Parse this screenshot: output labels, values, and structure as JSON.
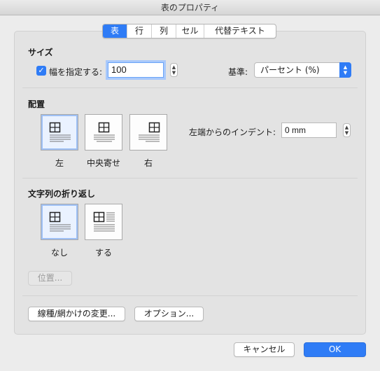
{
  "window": {
    "title": "表のプロパティ"
  },
  "tabs": [
    {
      "label": "表",
      "active": true
    },
    {
      "label": "行",
      "active": false
    },
    {
      "label": "列",
      "active": false
    },
    {
      "label": "セル",
      "active": false
    },
    {
      "label": "代替テキスト",
      "active": false
    }
  ],
  "size": {
    "section_title": "サイズ",
    "width_checkbox_label": "幅を指定する:",
    "width_checked": true,
    "width_value": "100",
    "basis_label": "基準:",
    "basis_value": "パーセント (%)"
  },
  "alignment": {
    "section_title": "配置",
    "options": [
      {
        "label": "左",
        "selected": true
      },
      {
        "label": "中央寄せ",
        "selected": false
      },
      {
        "label": "右",
        "selected": false
      }
    ],
    "indent_label": "左端からのインデント:",
    "indent_value": "0 mm"
  },
  "wrapping": {
    "section_title": "文字列の折り返し",
    "options": [
      {
        "label": "なし",
        "selected": true
      },
      {
        "label": "する",
        "selected": false
      }
    ],
    "position_button": "位置..."
  },
  "buttons": {
    "borders": "線種/網かけの変更...",
    "options": "オプション...",
    "cancel": "キャンセル",
    "ok": "OK"
  },
  "colors": {
    "accent": "#2f7cf6",
    "background": "#ececec"
  }
}
